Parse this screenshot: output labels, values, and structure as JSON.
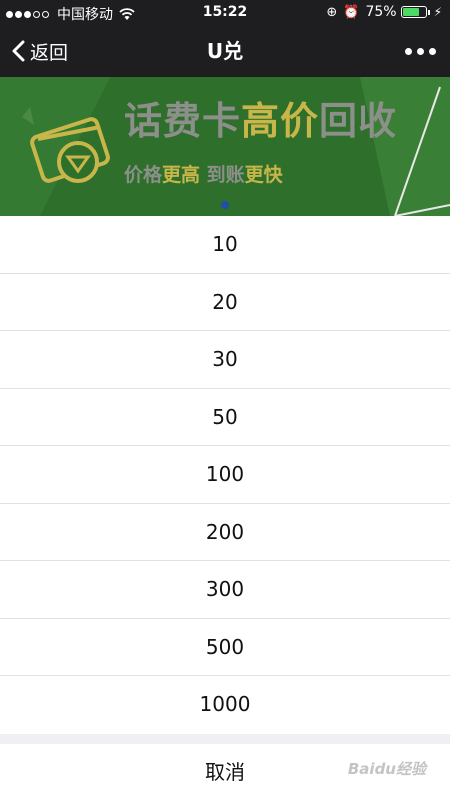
{
  "status_bar": {
    "carrier": "中国移动",
    "time": "15:22",
    "battery_percent": "75%",
    "battery_level": 0.75,
    "icons": [
      "signal-icon",
      "wifi-icon",
      "rotation-lock-icon",
      "alarm-icon",
      "battery-icon",
      "charging-icon"
    ]
  },
  "nav": {
    "back_label": "返回",
    "title": "U兑",
    "more_icon": "more-dots-icon"
  },
  "banner": {
    "title_part1": "话费卡",
    "title_part2": "高价",
    "title_part3": "回收",
    "subtitle_part1": "价格",
    "subtitle_part2": "更高",
    "subtitle_part3": " 到账",
    "subtitle_part4": "更快",
    "colors": {
      "background": "#2d6f2b",
      "highlight": "#c9b64a",
      "text": "#8d8f8a"
    }
  },
  "sheet": {
    "options": [
      "10",
      "20",
      "30",
      "50",
      "100",
      "200",
      "300",
      "500",
      "1000"
    ],
    "cancel_label": "取消"
  },
  "watermark": "Baidu经验"
}
